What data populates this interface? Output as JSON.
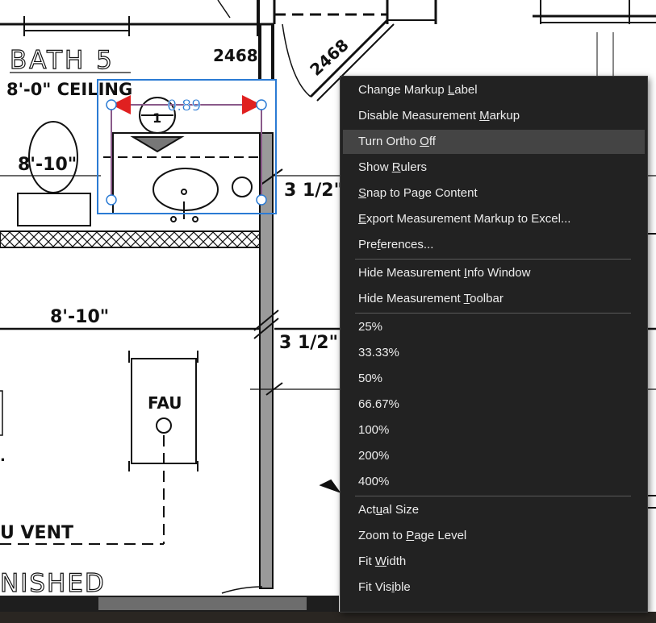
{
  "floor_plan": {
    "labels": {
      "room": "BATH 5",
      "ceiling": "8'-0\" CEILING",
      "door_size": "2468",
      "door_size_angled": "2468",
      "height_left": "8'-10\"",
      "height_mid": "8'-10\"",
      "wall_thickness_upper": "3 1/2\"",
      "wall_thickness_lower": "3 1/2\"",
      "fau": "FAU",
      "vent": "U VENT",
      "finished": "NISHED",
      "detail_marker": "1",
      "left_edge_fragment": "."
    },
    "measurement": {
      "value": "0.89"
    }
  },
  "context_menu": {
    "items": [
      {
        "label": "Change Markup Label",
        "underline_index": 14
      },
      {
        "label": "Disable Measurement Markup",
        "underline_index": 20
      },
      {
        "label": "Turn Ortho Off",
        "underline_index": 11
      },
      {
        "label": "Show Rulers",
        "underline_index": 5
      },
      {
        "label": "Snap to Page Content",
        "underline_index": 0
      },
      {
        "label": "Export Measurement Markup to Excel...",
        "underline_index": 0
      },
      {
        "label": "Preferences...",
        "underline_index": 3
      },
      {
        "label": "Hide Measurement Info Window",
        "underline_index": 17
      },
      {
        "label": "Hide Measurement Toolbar",
        "underline_index": 17
      },
      {
        "label": "25%"
      },
      {
        "label": "33.33%"
      },
      {
        "label": "50%"
      },
      {
        "label": "66.67%"
      },
      {
        "label": "100%"
      },
      {
        "label": "200%"
      },
      {
        "label": "400%"
      },
      {
        "label": "Actual Size",
        "underline_index": 3
      },
      {
        "label": "Zoom to Page Level",
        "underline_index": 8
      },
      {
        "label": "Fit Width",
        "underline_index": 4
      },
      {
        "label": "Fit Visible",
        "underline_index": 7
      }
    ],
    "highlighted": "Turn Ortho Off"
  },
  "colors": {
    "menu_bg": "#222222",
    "menu_highlight": "#444444",
    "menu_text": "#ececec",
    "selection_box": "#2b7bd4",
    "measure_arrow": "#e02020",
    "measure_line": "#8a5a8a"
  }
}
